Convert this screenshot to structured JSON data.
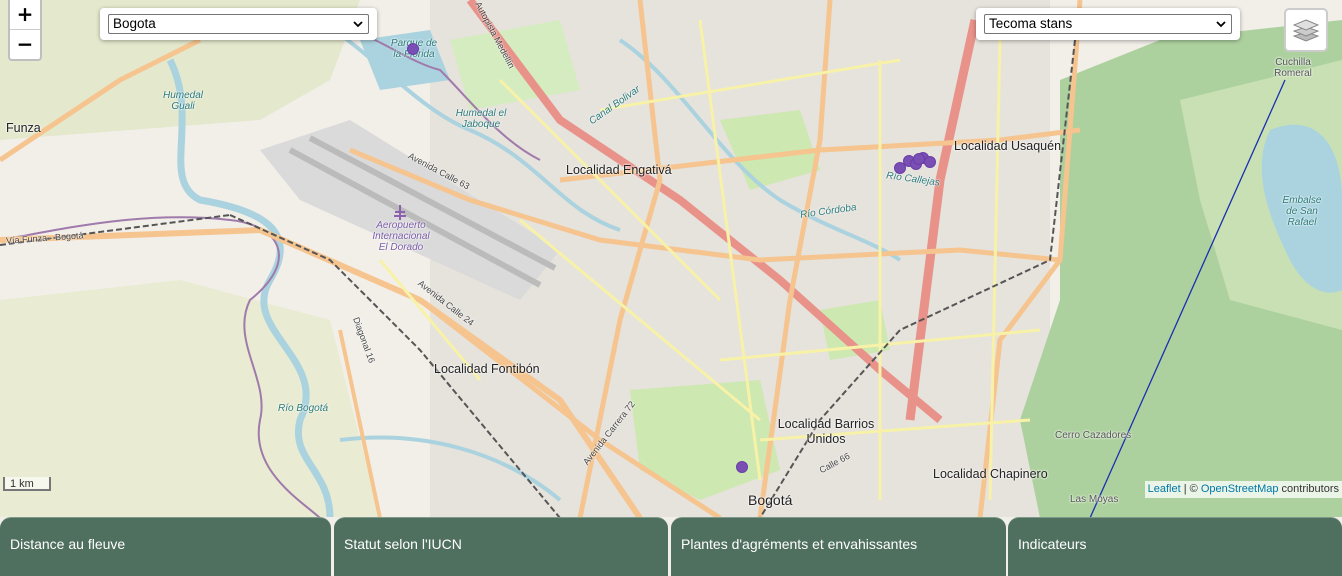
{
  "map": {
    "place_labels": [
      {
        "text": "Funza",
        "cls": "big"
      },
      {
        "text": "Localidad Engativá",
        "cls": "big"
      },
      {
        "text": "Localidad Usaquén",
        "cls": "big"
      },
      {
        "text": "Localidad Fontibón",
        "cls": "big"
      },
      {
        "text": "Localidad Barrios Unidos",
        "cls": "big"
      },
      {
        "text": "Localidad Chapinero",
        "cls": "big"
      },
      {
        "text": "Bogotá",
        "cls": "big"
      },
      {
        "text": "Aeropuerto Internacional El Dorado",
        "cls": "small"
      },
      {
        "text": "Parque de la Florida",
        "cls": "small"
      },
      {
        "text": "Humedal Guali",
        "cls": "small"
      },
      {
        "text": "Humedal el Jaboque",
        "cls": "small"
      },
      {
        "text": "Embalse de San Rafael",
        "cls": "small"
      },
      {
        "text": "Cuchilla Romeral",
        "cls": "small"
      },
      {
        "text": "Cerro Cazadores",
        "cls": "small"
      },
      {
        "text": "Las Moyas",
        "cls": "small"
      },
      {
        "text": "Río Bogotá",
        "cls": "small"
      },
      {
        "text": "Avenida Calle 63",
        "cls": "road"
      },
      {
        "text": "Vía Funza - Bogotá",
        "cls": "road"
      },
      {
        "text": "Autopista Medellín",
        "cls": "road"
      },
      {
        "text": "Avenida Calle 24",
        "cls": "road"
      },
      {
        "text": "Avenida Carrera 72",
        "cls": "road"
      },
      {
        "text": "Diagonal 16",
        "cls": "road"
      },
      {
        "text": "Canal Bolivar",
        "cls": "small"
      },
      {
        "text": "Río Córdoba",
        "cls": "small"
      },
      {
        "text": "Río Callejas",
        "cls": "small"
      },
      {
        "text": "Calle 66",
        "cls": "road"
      }
    ],
    "marker_color": "#7a4fb5",
    "marker_count": 8
  },
  "controls": {
    "zoom_in": "+",
    "zoom_out": "−",
    "city_select": "Bogota",
    "species_select": "Tecoma stans",
    "layers_icon": "layers-icon"
  },
  "scale": "1 km",
  "attribution": {
    "leaflet": "Leaflet",
    "sep": " | © ",
    "osm": "OpenStreetMap",
    "suffix": " contributors"
  },
  "tabs": [
    "Distance au fleuve",
    "Statut selon l'IUCN",
    "Plantes d'agréments et envahissantes",
    "Indicateurs"
  ],
  "colors": {
    "tab_bg": "#4f6f5f",
    "map_bg": "#f2efe9",
    "green_area": "#cde8b0",
    "forest": "#add19e",
    "water": "#aad3df",
    "motorway": "#e8928a",
    "primary_road": "#f6c48e"
  }
}
